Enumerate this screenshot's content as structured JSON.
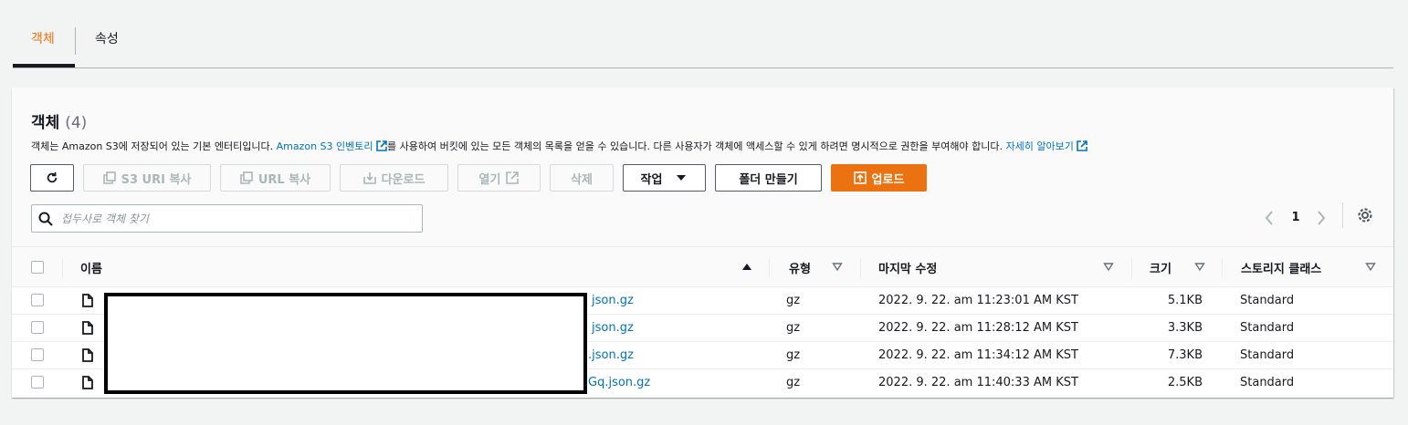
{
  "tabs": {
    "objects": "객체",
    "properties": "속성"
  },
  "panel": {
    "title": "객체",
    "count": "(4)",
    "desc_pre": "객체는 Amazon S3에 저장되어 있는 기본 엔터티입니다. ",
    "desc_link1": "Amazon S3 인벤토리",
    "desc_mid": "를 사용하여 버킷에 있는 모든 객체의 목록을 얻을 수 있습니다. 다른 사용자가 객체에 액세스할 수 있게 하려면 명시적으로 권한을 부여해야 합니다. ",
    "desc_link2": "자세히 알아보기"
  },
  "toolbar": {
    "refresh": "",
    "copy_s3_uri": "S3 URI 복사",
    "copy_url": "URL 복사",
    "download": "다운로드",
    "open": "열기",
    "delete": "삭제",
    "actions": "작업",
    "create_folder": "폴더 만들기",
    "upload": "업로드"
  },
  "search": {
    "placeholder": "접두사로 객체 찾기"
  },
  "pagination": {
    "page": "1"
  },
  "table": {
    "headers": {
      "name": "이름",
      "type": "유형",
      "modified": "마지막 수정",
      "size": "크기",
      "storage": "스토리지 클래스"
    },
    "rows": [
      {
        "name": "json.gz",
        "type": "gz",
        "modified": "2022. 9. 22. am 11:23:01 AM KST",
        "size": "5.1KB",
        "storage": "Standard"
      },
      {
        "name": "json.gz",
        "type": "gz",
        "modified": "2022. 9. 22. am 11:28:12 AM KST",
        "size": "3.3KB",
        "storage": "Standard"
      },
      {
        "name": ".json.gz",
        "type": "gz",
        "modified": "2022. 9. 22. am 11:34:12 AM KST",
        "size": "7.3KB",
        "storage": "Standard"
      },
      {
        "name": "Gq.json.gz",
        "type": "gz",
        "modified": "2022. 9. 22. am 11:40:33 AM KST",
        "size": "2.5KB",
        "storage": "Standard"
      }
    ]
  },
  "colors": {
    "accent": "#ec7211",
    "link": "#0073bb",
    "text": "#16191f",
    "disabled": "#aab7b8"
  }
}
